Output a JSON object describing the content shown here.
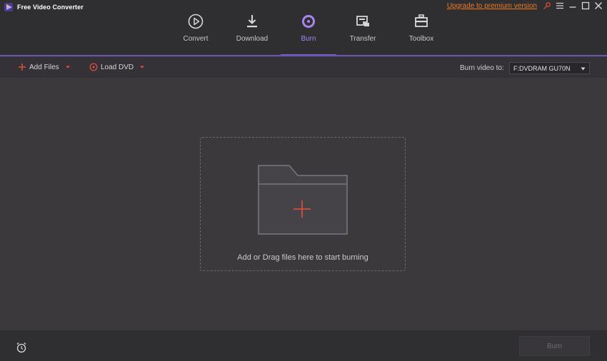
{
  "app": {
    "title": "Free Video Converter",
    "upgrade_link": "Upgrade to premium version"
  },
  "nav": {
    "tabs": [
      {
        "label": "Convert",
        "icon": "play-circle-icon",
        "active": false
      },
      {
        "label": "Download",
        "icon": "download-icon",
        "active": false
      },
      {
        "label": "Burn",
        "icon": "disc-icon",
        "active": true
      },
      {
        "label": "Transfer",
        "icon": "transfer-icon",
        "active": false
      },
      {
        "label": "Toolbox",
        "icon": "toolbox-icon",
        "active": false
      }
    ]
  },
  "toolbar": {
    "add_files": "Add Files",
    "load_dvd": "Load DVD",
    "burn_to_label": "Burn video to:",
    "burn_target": "F:DVDRAM GU70N"
  },
  "drop_zone": {
    "text": "Add or Drag files here to start burning"
  },
  "bottom": {
    "burn_button": "Burn"
  },
  "colors": {
    "accent": "#7b5fd4",
    "accent_text": "#a786f0",
    "upgrade": "#f07a22",
    "plus": "#e8503c",
    "background": "#3b393c",
    "header": "#2f2e31"
  }
}
